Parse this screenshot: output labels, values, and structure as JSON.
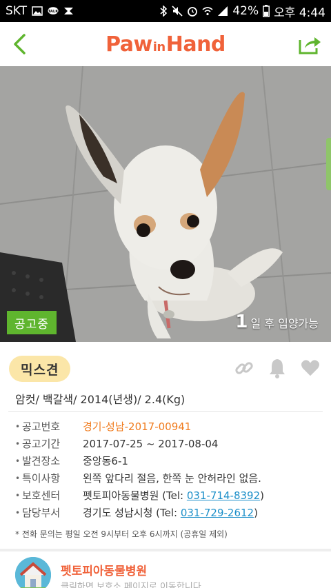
{
  "status_bar": {
    "carrier": "SKT",
    "battery": "42%",
    "time": "오후 4:44"
  },
  "app_bar": {
    "logo_pre": "Paw",
    "logo_in": "in",
    "logo_post": "Hand",
    "brand_color": "#f0623a"
  },
  "photo": {
    "status_label": "공고중",
    "adopt_days": "1",
    "adopt_text": "일 후 입양가능"
  },
  "animal": {
    "breed": "믹스견",
    "summary": "암컷/ 백갈색/ 2014(년생)/ 2.4(Kg)"
  },
  "info": [
    {
      "label": "공고번호",
      "value": "경기-성남-2017-00941"
    },
    {
      "label": "공고기간",
      "value": "2017-07-25 ~ 2017-08-04"
    },
    {
      "label": "발견장소",
      "value": "중앙동6-1"
    },
    {
      "label": "특이사항",
      "value": "왼쪽 앞다리 절음, 한쪽 눈 안허라인 없음."
    },
    {
      "label": "보호센터",
      "value": "펫토피아동물병원 (Tel: ",
      "phone": "031-714-8392",
      "suffix": ")"
    },
    {
      "label": "담당부서",
      "value": "경기도 성남시청 (Tel: ",
      "phone": "031-729-2612",
      "suffix": ")"
    }
  ],
  "footnote": "* 전화 문의는 평일 오전 9시부터 오후 6시까지 (공휴일 제외)",
  "hospital": {
    "name": "펫토피아동물병원",
    "subtitle": "클릭하면 보호소 페이지로 이동합니다"
  },
  "colors": {
    "accent_green": "#5fb52e",
    "orange": "#f07b1d",
    "link_blue": "#1c8fc9"
  }
}
